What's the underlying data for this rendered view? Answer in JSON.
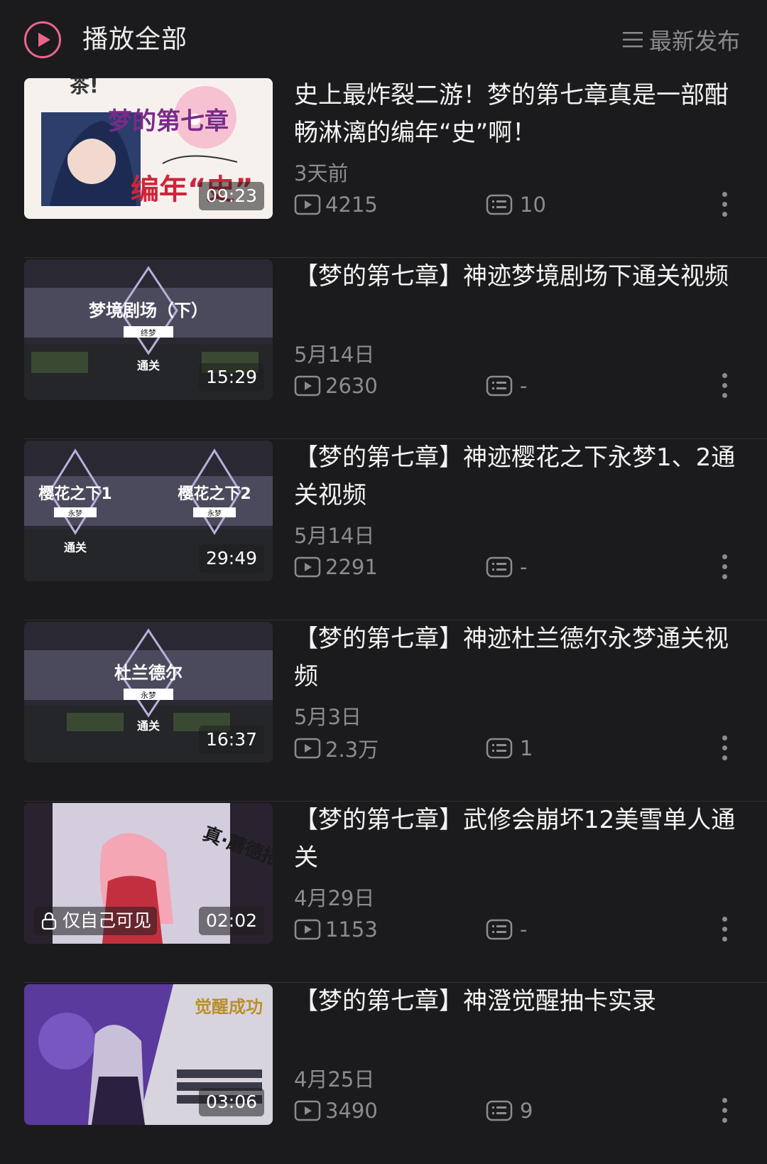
{
  "header": {
    "play_all_label": "播放全部",
    "sort_label": "最新发布",
    "accent_color": "#e8668c"
  },
  "videos": [
    {
      "title": "史上最炸裂二游！梦的第七章真是一部酣畅淋漓的编年“史”啊！",
      "date": "3天前",
      "views": "4215",
      "comments": "10",
      "duration": "09:23",
      "thumb_text": [
        "梦的第七章",
        "编年“史”"
      ],
      "private": ""
    },
    {
      "title": "【梦的第七章】神迹梦境剧场下通关视频",
      "date": "5月14日",
      "views": "2630",
      "comments": "-",
      "duration": "15:29",
      "thumb_text": [
        "梦境剧场（下）",
        "终梦",
        "通关"
      ],
      "private": ""
    },
    {
      "title": "【梦的第七章】神迹樱花之下永梦1、2通关视频",
      "date": "5月14日",
      "views": "2291",
      "comments": "-",
      "duration": "29:49",
      "thumb_text": [
        "樱花之下1",
        "永梦",
        "樱花之下2",
        "永梦",
        "通关"
      ],
      "private": ""
    },
    {
      "title": "【梦的第七章】神迹杜兰德尔永梦通关视频",
      "date": "5月3日",
      "views": "2.3万",
      "comments": "1",
      "duration": "16:37",
      "thumb_text": [
        "杜兰德尔",
        "永梦",
        "通关"
      ],
      "private": ""
    },
    {
      "title": "【梦的第七章】武修会崩坏12美雪单人通关",
      "date": "4月29日",
      "views": "1153",
      "comments": "-",
      "duration": "02:02",
      "thumb_text": [
        "真·蘑德招脚"
      ],
      "private": "仅自己可见"
    },
    {
      "title": "【梦的第七章】神澄觉醒抽卡实录",
      "date": "4月25日",
      "views": "3490",
      "comments": "9",
      "duration": "03:06",
      "thumb_text": [
        "觉醒成功"
      ],
      "private": ""
    }
  ]
}
